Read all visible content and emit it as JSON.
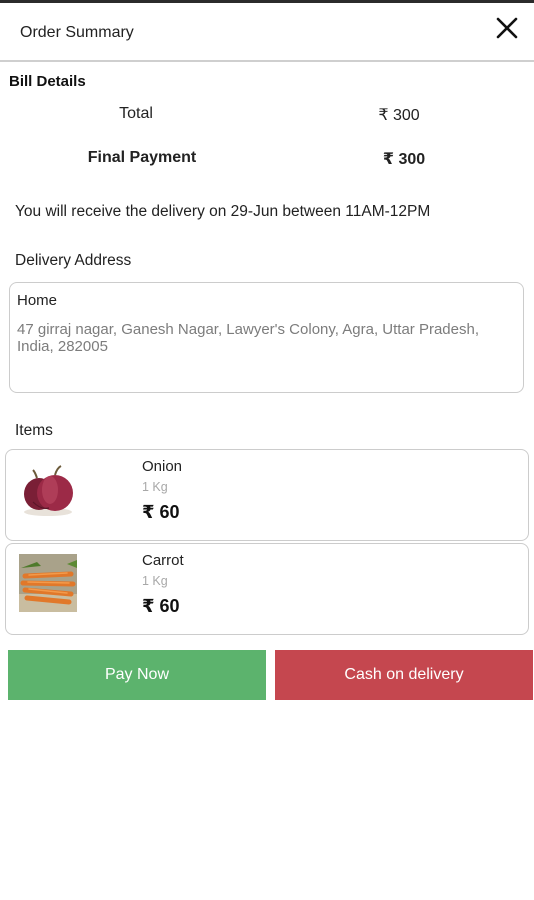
{
  "header": {
    "title": "Order Summary",
    "close_icon": "close-icon"
  },
  "bill": {
    "heading": "Bill Details",
    "total_label": "Total",
    "total_value": "₹ 300",
    "final_label": "Final Payment",
    "final_value": "₹ 300"
  },
  "delivery_note": "You will receive the delivery on 29-Jun between 11AM-12PM",
  "address": {
    "heading": "Delivery Address",
    "label": "Home",
    "text": "47 girraj nagar, Ganesh Nagar, Lawyer's Colony, Agra, Uttar Pradesh, India, 282005"
  },
  "items": {
    "heading": "Items",
    "list": [
      {
        "name": "Onion",
        "qty": "1 Kg",
        "price": "₹ 60",
        "icon": "onion-image"
      },
      {
        "name": "Carrot",
        "qty": "1 Kg",
        "price": "₹ 60",
        "icon": "carrot-image"
      }
    ]
  },
  "actions": {
    "pay_now": "Pay Now",
    "cod": "Cash on delivery"
  },
  "colors": {
    "pay_now": "#5cb36d",
    "cod": "#c5474f"
  }
}
